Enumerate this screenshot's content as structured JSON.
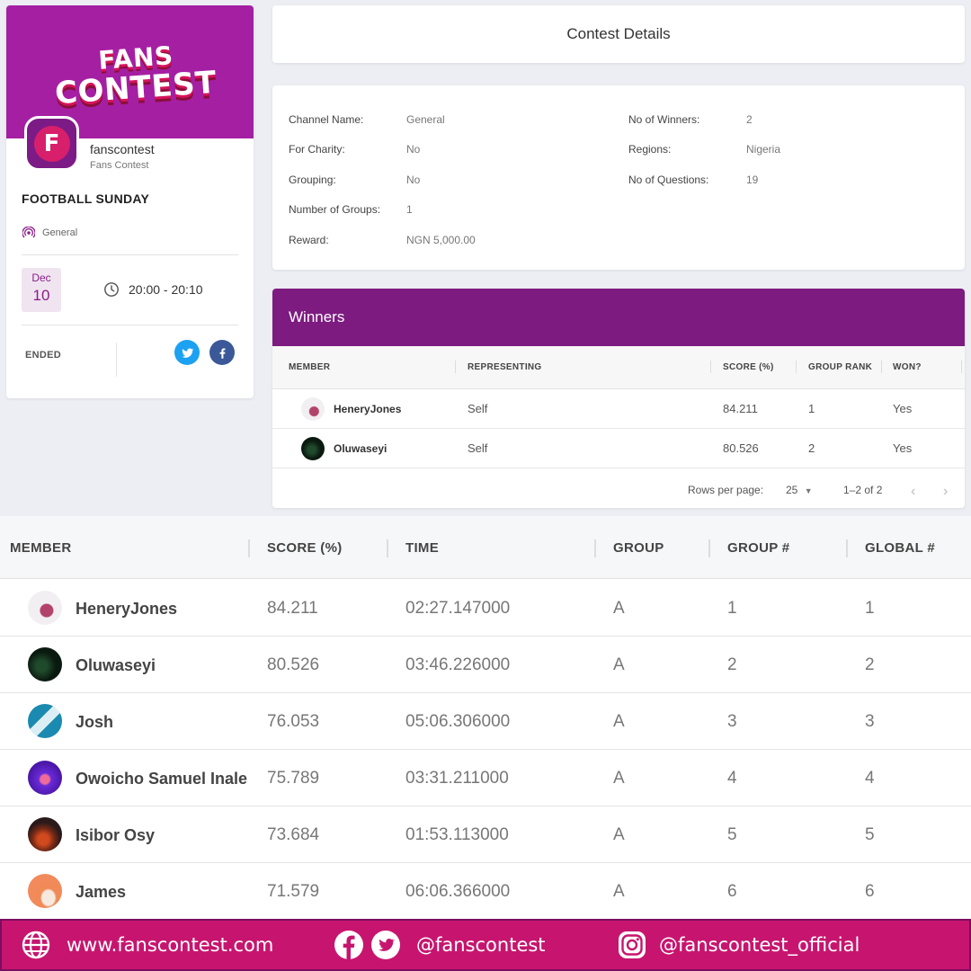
{
  "profile": {
    "logo_line1": "FANS",
    "logo_line2": "CONTEST",
    "avatar_letter": "F",
    "handle": "fanscontest",
    "display_name": "Fans Contest",
    "contest_title": "FOOTBALL SUNDAY",
    "channel": "General",
    "date_month": "Dec",
    "date_day": "10",
    "time_range": "20:00 - 20:10",
    "status": "ENDED"
  },
  "details": {
    "title": "Contest Details",
    "left": [
      {
        "key": "Channel Name:",
        "value": "General"
      },
      {
        "key": "For Charity:",
        "value": "No"
      },
      {
        "key": "Grouping:",
        "value": "No"
      },
      {
        "key": "Number of Groups:",
        "value": "1"
      },
      {
        "key": "Reward:",
        "value": "NGN 5,000.00"
      }
    ],
    "right": [
      {
        "key": "No of Winners:",
        "value": "2"
      },
      {
        "key": "Regions:",
        "value": "Nigeria"
      },
      {
        "key": "No of Questions:",
        "value": "19"
      }
    ]
  },
  "winners": {
    "title": "Winners",
    "headers": [
      "MEMBER",
      "REPRESENTING",
      "SCORE (%)",
      "GROUP RANK",
      "WON?"
    ],
    "rows": [
      {
        "member": "HeneryJones",
        "representing": "Self",
        "score": "84.211",
        "rank": "1",
        "won": "Yes"
      },
      {
        "member": "Oluwaseyi",
        "representing": "Self",
        "score": "80.526",
        "rank": "2",
        "won": "Yes"
      }
    ],
    "rows_per_page_label": "Rows per page:",
    "rows_per_page": "25",
    "range": "1–2 of 2"
  },
  "leaderboard": {
    "headers": [
      "MEMBER",
      "SCORE (%)",
      "TIME",
      "GROUP",
      "GROUP #",
      "GLOBAL #"
    ],
    "rows": [
      {
        "member": "HeneryJones",
        "score": "84.211",
        "time": "02:27.147000",
        "group": "A",
        "group_rank": "1",
        "global_rank": "1"
      },
      {
        "member": "Oluwaseyi",
        "score": "80.526",
        "time": "03:46.226000",
        "group": "A",
        "group_rank": "2",
        "global_rank": "2"
      },
      {
        "member": "Josh",
        "score": "76.053",
        "time": "05:06.306000",
        "group": "A",
        "group_rank": "3",
        "global_rank": "3"
      },
      {
        "member": "Owoicho Samuel Inale",
        "score": "75.789",
        "time": "03:31.211000",
        "group": "A",
        "group_rank": "4",
        "global_rank": "4"
      },
      {
        "member": "Isibor Osy",
        "score": "73.684",
        "time": "01:53.113000",
        "group": "A",
        "group_rank": "5",
        "global_rank": "5"
      },
      {
        "member": "James",
        "score": "71.579",
        "time": "06:06.366000",
        "group": "A",
        "group_rank": "6",
        "global_rank": "6"
      }
    ]
  },
  "footer": {
    "website": "www.fanscontest.com",
    "social_handle": "@fanscontest",
    "instagram_handle": "@fanscontest_official"
  },
  "colors": {
    "brand_purple": "#a51fa3",
    "winners_header": "#7d1b80",
    "footer_pink": "#c7156f",
    "twitter": "#1da1f2",
    "facebook": "#3b5998"
  }
}
